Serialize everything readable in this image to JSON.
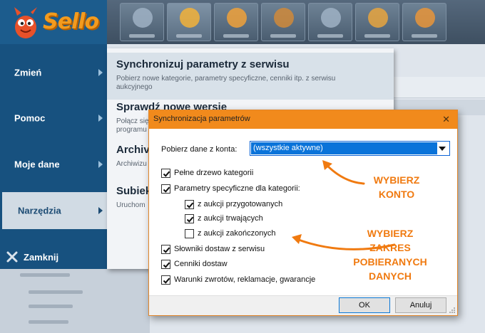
{
  "app": {
    "logo_text": "Sello"
  },
  "toolbar": {
    "tiles": [
      "tile-start",
      "tile-narzedzia",
      "tile-transakcje",
      "tile-paczki",
      "tile-magazyn",
      "tile-wysylki",
      "tile-serwis"
    ]
  },
  "sidebar": {
    "items": [
      {
        "label": "Zmień"
      },
      {
        "label": "Pomoc"
      },
      {
        "label": "Moje dane"
      },
      {
        "label": "Narzędzia"
      }
    ],
    "close_label": "Zamknij"
  },
  "submenu": {
    "items": [
      {
        "title": "Synchronizuj parametry z serwisu",
        "desc": "Pobierz nowe kategorie, parametry specyficzne, cenniki itp. z serwisu aukcyjnego"
      },
      {
        "title": "Sprawdź nowe wersje",
        "desc_1": "Połącz się",
        "desc_2": "programu"
      },
      {
        "title": "Archiv",
        "desc": "Archiwizu"
      },
      {
        "title": "Subiek",
        "desc": "Uruchom"
      }
    ]
  },
  "dialog": {
    "title": "Synchronizacja parametrów",
    "account_label": "Pobierz dane z konta:",
    "account_value": "(wszystkie aktywne)",
    "options": [
      {
        "label": "Pełne drzewo kategorii",
        "checked": true
      },
      {
        "label": "Parametry specyficzne dla kategorii:",
        "checked": true
      },
      {
        "label": "z aukcji przygotowanych",
        "checked": true
      },
      {
        "label": "z aukcji trwających",
        "checked": true
      },
      {
        "label": "z aukcji zakończonych",
        "checked": false
      },
      {
        "label": "Słowniki dostaw z serwisu",
        "checked": true
      },
      {
        "label": "Cenniki dostaw",
        "checked": true
      },
      {
        "label": "Warunki zwrotów, reklamacje, gwarancje",
        "checked": true
      }
    ],
    "ok_label": "OK",
    "cancel_label": "Anuluj"
  },
  "annotations": {
    "account_note": [
      "WYBIERZ",
      "KONTO"
    ],
    "range_note": [
      "WYBIERZ",
      "ZAKRES",
      "POBIERANYCH",
      "DANYCH"
    ],
    "color": "#f07a10"
  },
  "colors": {
    "sidebar": "#17517f",
    "dialog_title": "#f18a1c",
    "selection": "#0a73d9",
    "brand": "#f39b1e"
  }
}
